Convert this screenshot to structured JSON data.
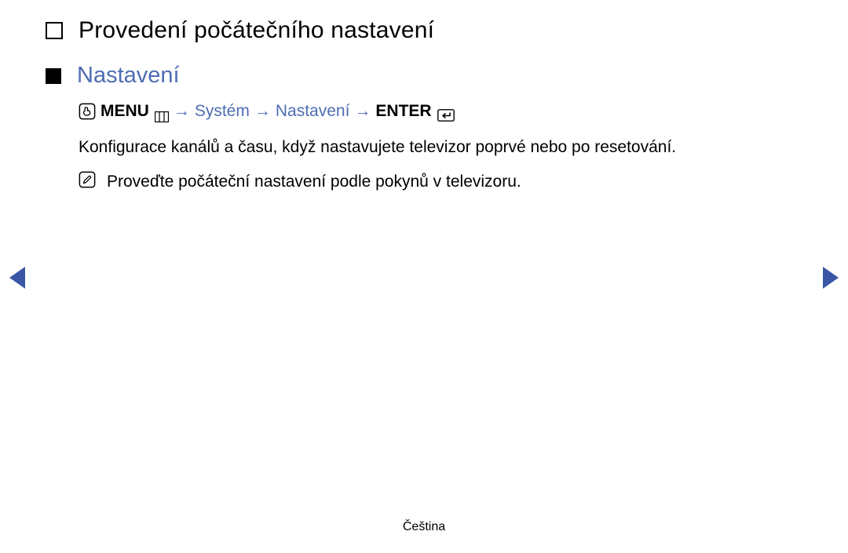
{
  "title": "Provedení počátečního nastavení",
  "subtitle": "Nastavení",
  "nav": {
    "menu_label": "MENU",
    "system": "Systém",
    "settings": "Nastavení",
    "enter_label": "ENTER",
    "arrow": "→"
  },
  "body": "Konfigurace kanálů a času, když nastavujete televizor poprvé nebo po resetování.",
  "note": "Proveďte počáteční nastavení podle pokynů v televizoru.",
  "footer": {
    "language": "Čeština"
  },
  "colors": {
    "accent": "#4f6db3",
    "nav_arrow": "#3a57a6"
  }
}
